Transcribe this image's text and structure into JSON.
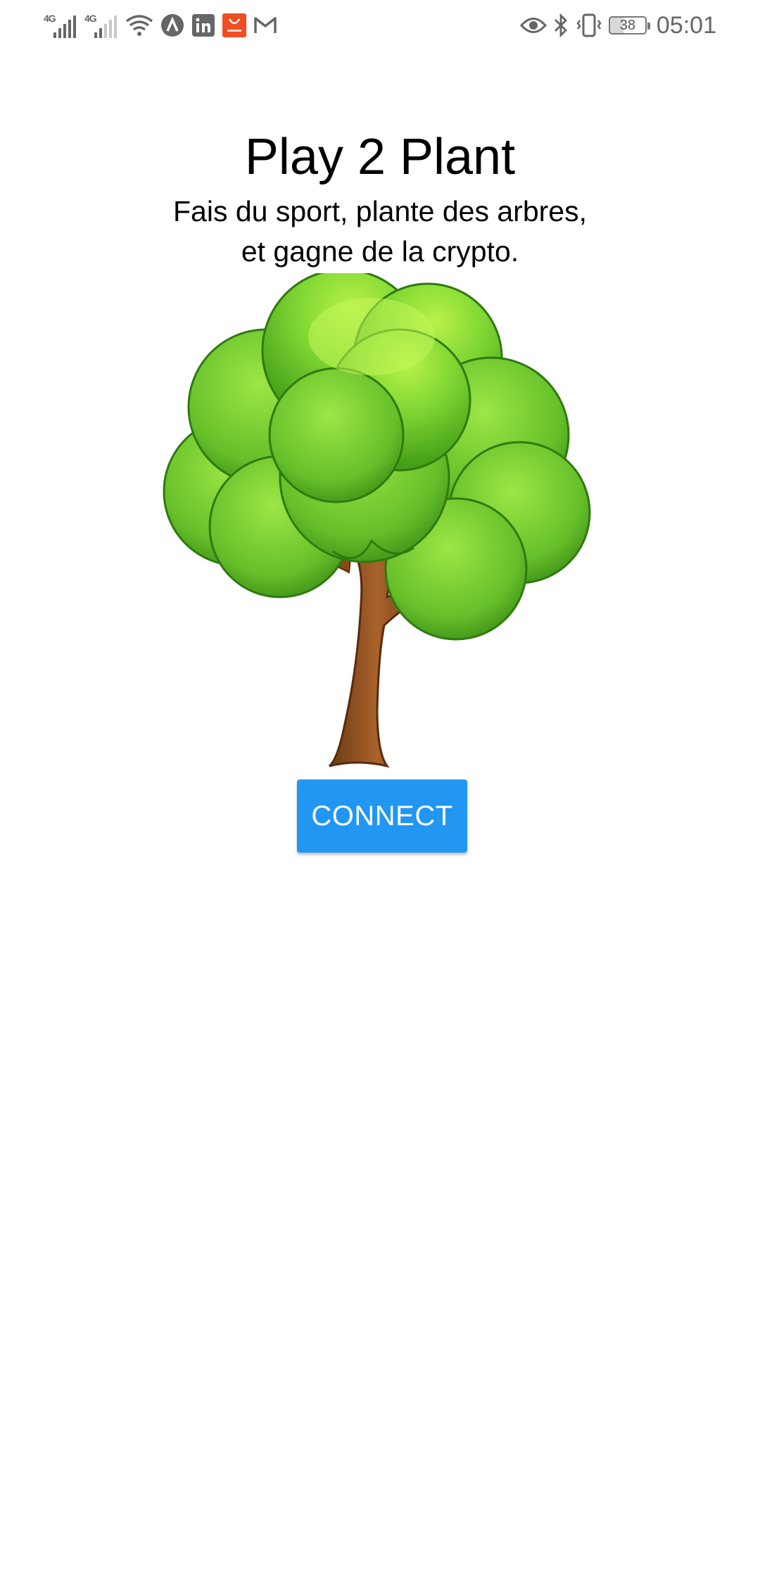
{
  "status_bar": {
    "time": "05:01",
    "battery": "38",
    "network_1": "4G",
    "network_2": "4G",
    "icons": [
      "signal-icon",
      "signal-icon",
      "wifi-icon",
      "app-a-icon",
      "linkedin-icon",
      "aliexpress-icon",
      "gmail-icon",
      "eye-icon",
      "bluetooth-icon",
      "vibrate-icon",
      "battery-icon"
    ]
  },
  "main": {
    "title": "Play 2 Plant",
    "subtitle_line1": "Fais du sport, plante des arbres,",
    "subtitle_line2": "et gagne de la crypto.",
    "image": "tree-illustration",
    "connect_label": "CONNECT"
  },
  "colors": {
    "accent": "#2196f3",
    "background": "#ffffff",
    "text": "#000000"
  }
}
